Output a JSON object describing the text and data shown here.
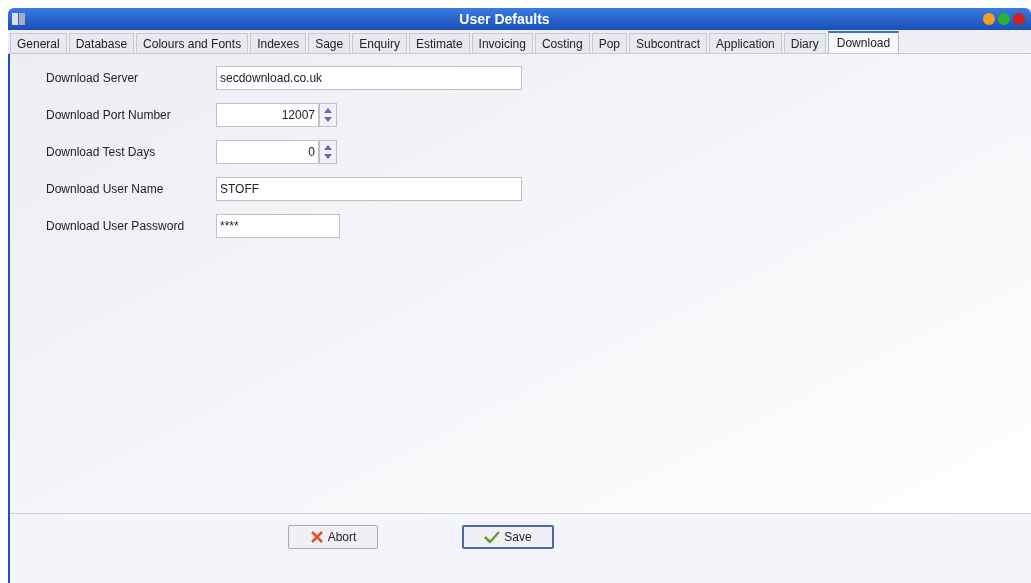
{
  "window": {
    "title": "User Defaults"
  },
  "tabs": [
    {
      "label": "General",
      "selected": false
    },
    {
      "label": "Database",
      "selected": false
    },
    {
      "label": "Colours and Fonts",
      "selected": false
    },
    {
      "label": "Indexes",
      "selected": false
    },
    {
      "label": "Sage",
      "selected": false
    },
    {
      "label": "Enquiry",
      "selected": false
    },
    {
      "label": "Estimate",
      "selected": false
    },
    {
      "label": "Invoicing",
      "selected": false
    },
    {
      "label": "Costing",
      "selected": false
    },
    {
      "label": "Pop",
      "selected": false
    },
    {
      "label": "Subcontract",
      "selected": false
    },
    {
      "label": "Application",
      "selected": false
    },
    {
      "label": "Diary",
      "selected": false
    },
    {
      "label": "Download",
      "selected": true
    }
  ],
  "fields": [
    {
      "label": "Download Server",
      "value": "secdownload.co.uk",
      "kind": "wide"
    },
    {
      "label": "Download Port Number",
      "value": "12007",
      "kind": "spin"
    },
    {
      "label": "Download Test Days",
      "value": "0",
      "kind": "spin"
    },
    {
      "label": "Download User Name",
      "value": "STOFF",
      "kind": "wide"
    },
    {
      "label": "Download User Password",
      "value": "****",
      "kind": "short"
    }
  ],
  "buttons": [
    {
      "label": "Abort",
      "kind": "abort"
    },
    {
      "label": "Save",
      "kind": "save"
    }
  ]
}
